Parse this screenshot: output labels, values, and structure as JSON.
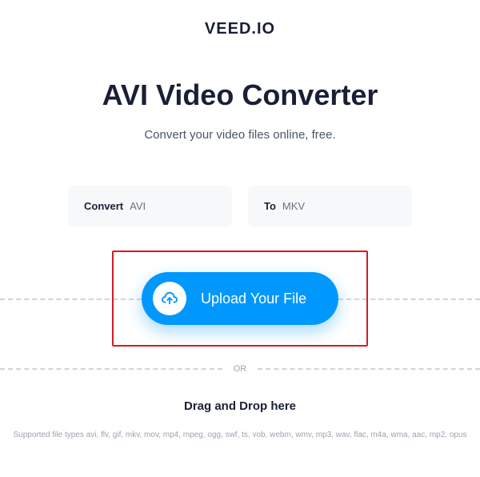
{
  "logo": "VEED.IO",
  "title": "AVI Video Converter",
  "subtitle": "Convert your video files online, free.",
  "convert": {
    "from_label": "Convert",
    "from_value": "AVI",
    "to_label": "To",
    "to_value": "MKV"
  },
  "upload": {
    "button_text": "Upload Your File"
  },
  "divider": "OR",
  "drag_text": "Drag and Drop here",
  "filetypes": "Supported file types avi, flv, gif, mkv, mov, mp4, mpeg, ogg, swf, ts, vob, webm, wmv, mp3, wav, flac, m4a, wma, aac, mp2, opus"
}
